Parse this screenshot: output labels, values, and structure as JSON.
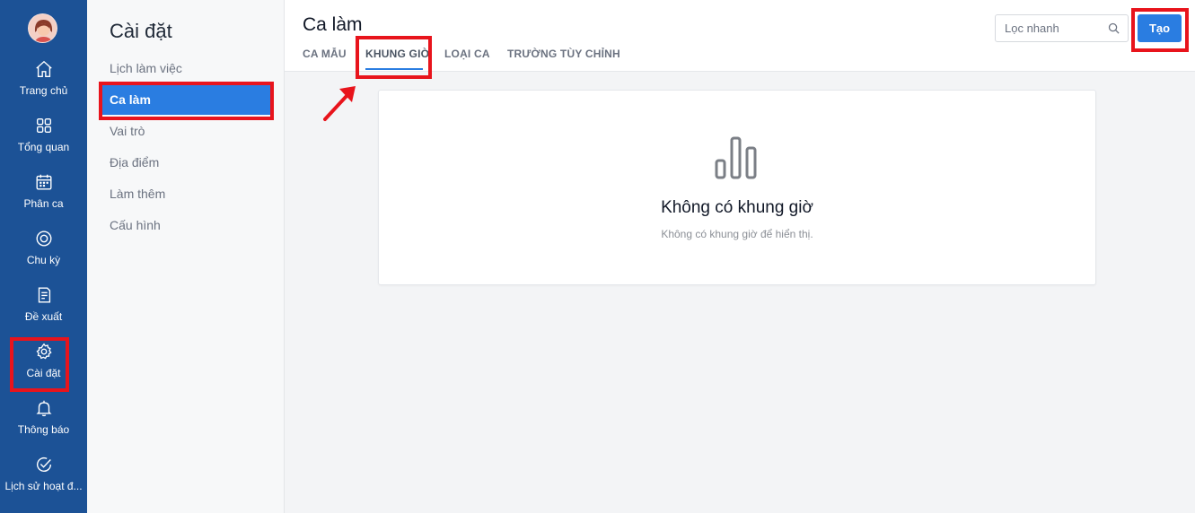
{
  "rail": {
    "items": [
      {
        "label": "Trang chủ",
        "icon": "home-icon"
      },
      {
        "label": "Tổng quan",
        "icon": "grid-icon"
      },
      {
        "label": "Phân ca",
        "icon": "calendar-icon"
      },
      {
        "label": "Chu kỳ",
        "icon": "cycle-icon"
      },
      {
        "label": "Đề xuất",
        "icon": "document-icon"
      },
      {
        "label": "Cài đặt",
        "icon": "gear-icon"
      },
      {
        "label": "Thông báo",
        "icon": "bell-icon"
      },
      {
        "label": "Lịch sử hoạt đ...",
        "icon": "check-circle-icon"
      }
    ]
  },
  "settings": {
    "title": "Cài đặt",
    "items": [
      {
        "label": "Lịch làm việc"
      },
      {
        "label": "Ca làm"
      },
      {
        "label": "Vai trò"
      },
      {
        "label": "Địa điểm"
      },
      {
        "label": "Làm thêm"
      },
      {
        "label": "Cấu hình"
      }
    ]
  },
  "main": {
    "title": "Ca làm",
    "tabs": [
      {
        "label": "CA MẪU"
      },
      {
        "label": "KHUNG GIỜ"
      },
      {
        "label": "LOẠI CA"
      },
      {
        "label": "TRƯỜNG TÙY CHỈNH"
      }
    ],
    "search_placeholder": "Lọc nhanh",
    "create_label": "Tạo"
  },
  "empty_state": {
    "title": "Không có khung giờ",
    "subtitle": "Không có khung giờ để hiển thị."
  },
  "colors": {
    "rail_bg": "#1c5296",
    "accent": "#2a7de1",
    "highlight": "#e8141c"
  }
}
